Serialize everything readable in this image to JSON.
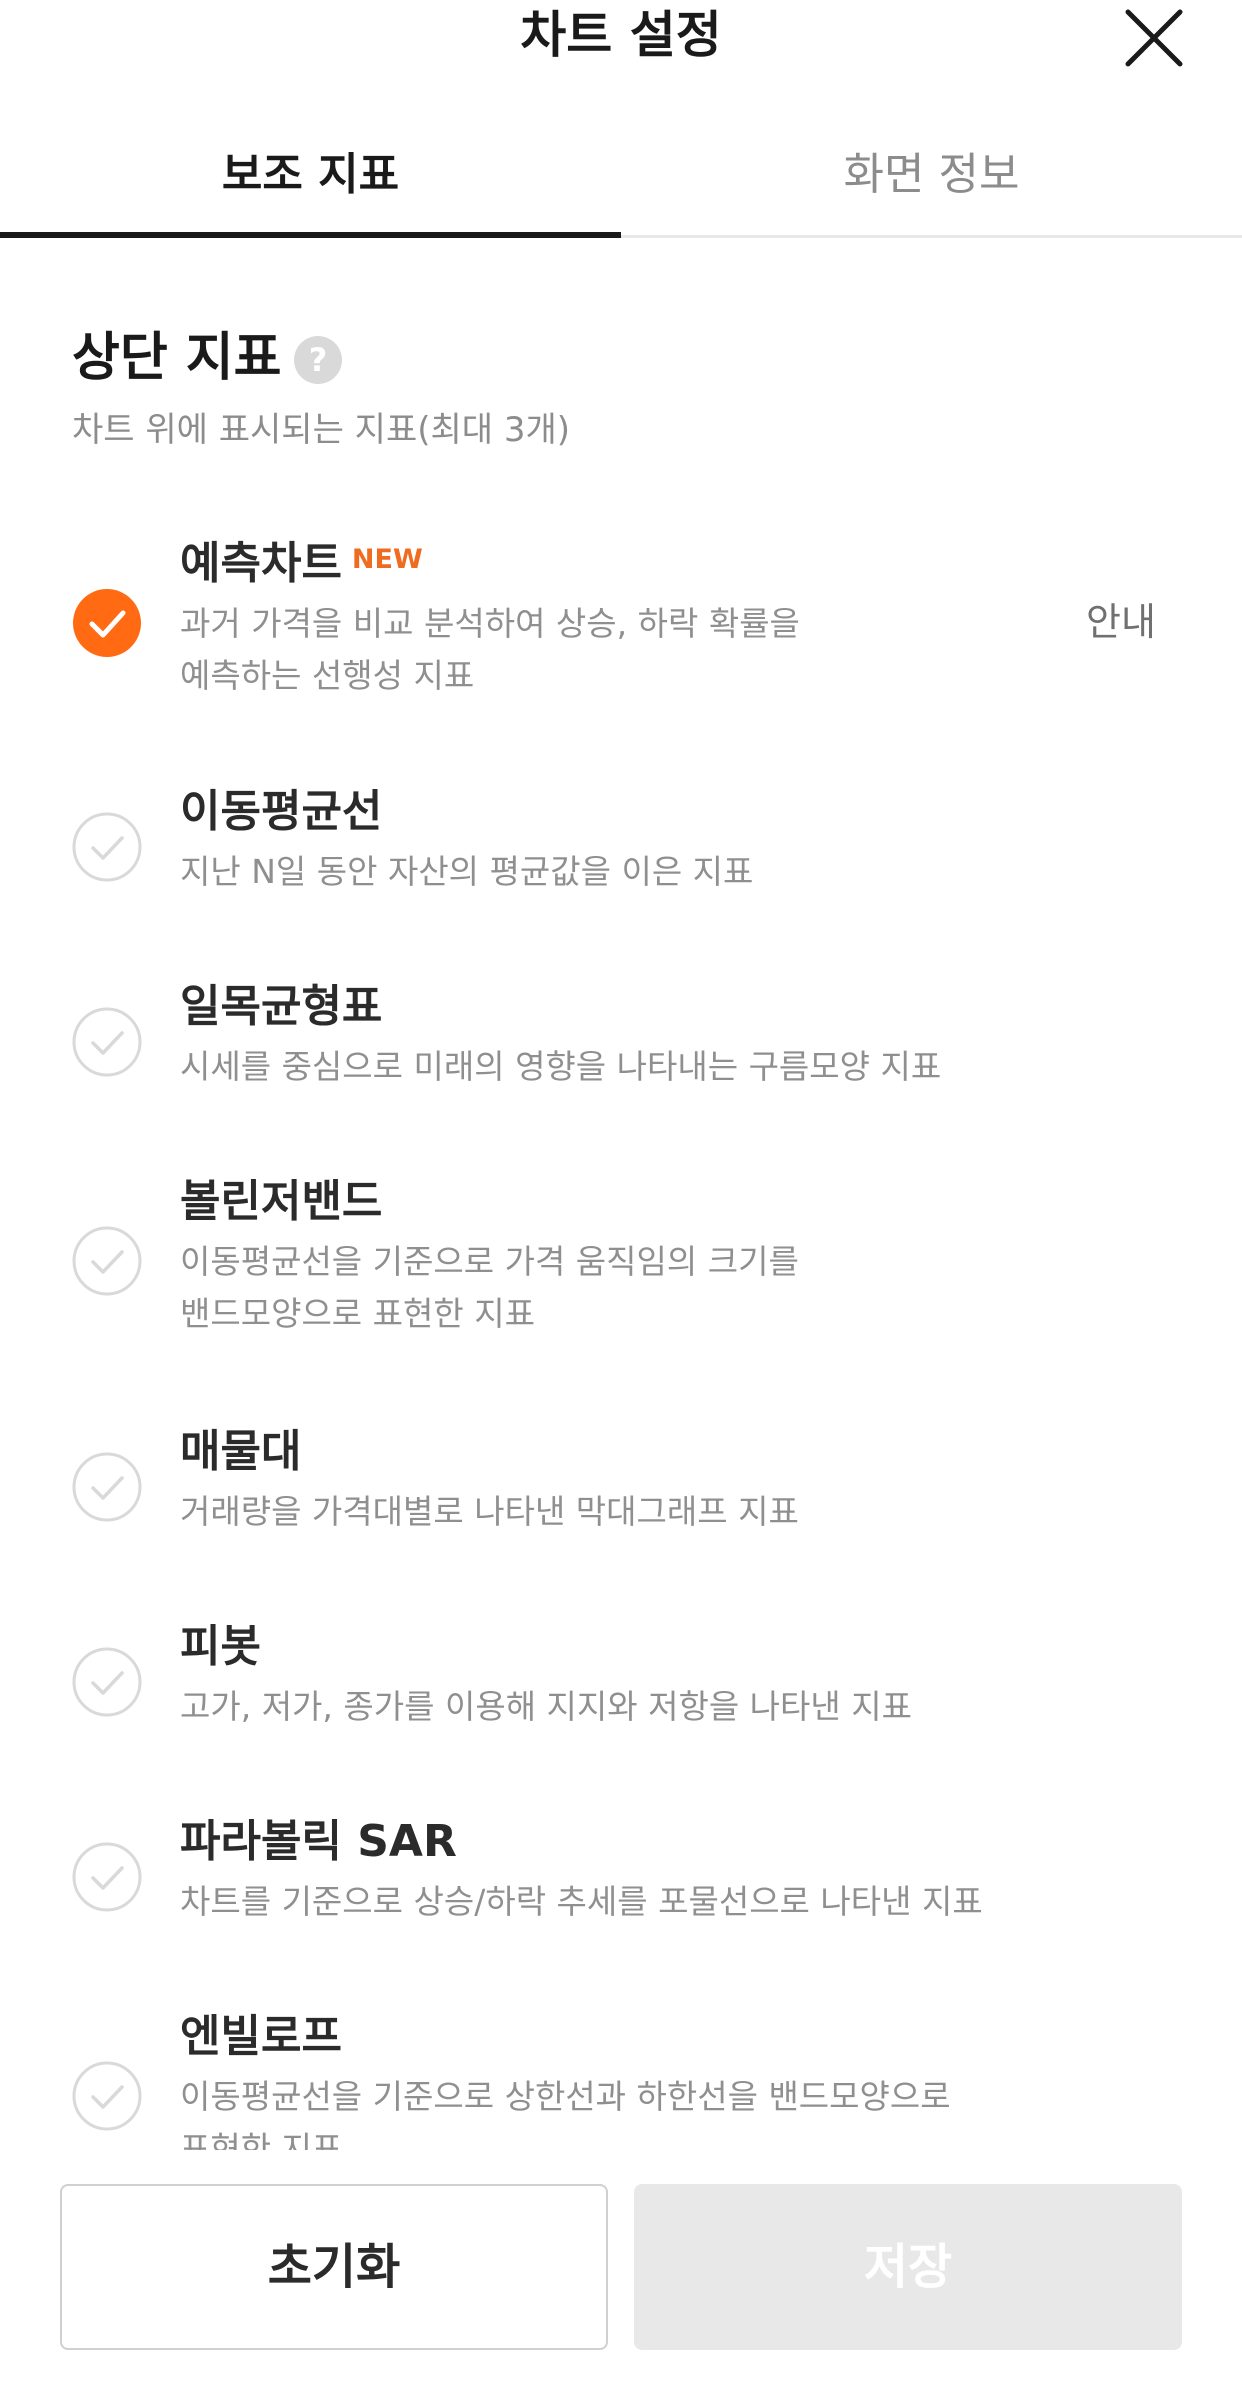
{
  "header": {
    "title": "차트 설정"
  },
  "tabs": [
    {
      "label": "보조 지표",
      "active": true
    },
    {
      "label": "화면 정보",
      "active": false
    }
  ],
  "section": {
    "title": "상단 지표",
    "help_symbol": "?",
    "subtitle": "차트 위에 표시되는 지표(최대 3개)"
  },
  "indicators": [
    {
      "title": "예측차트",
      "badge": "NEW",
      "desc_line1": "과거 가격을 비교 분석하여 상승, 하락 확률을",
      "desc_line2": "예측하는 선행성 지표",
      "info_label": "안내",
      "checked": true
    },
    {
      "title": "이동평균선",
      "desc_line1": "지난 N일 동안 자산의 평균값을 이은 지표",
      "checked": false
    },
    {
      "title": "일목균형표",
      "desc_line1": "시세를 중심으로 미래의 영향을 나타내는 구름모양 지표",
      "checked": false
    },
    {
      "title": "볼린저밴드",
      "desc_line1": "이동평균선을 기준으로 가격 움직임의 크기를",
      "desc_line2": "밴드모양으로 표현한 지표",
      "checked": false
    },
    {
      "title": "매물대",
      "desc_line1": "거래량을 가격대별로 나타낸 막대그래프 지표",
      "checked": false
    },
    {
      "title": "피봇",
      "desc_line1": "고가, 저가, 종가를 이용해 지지와 저항을 나타낸 지표",
      "checked": false
    },
    {
      "title": "파라볼릭 SAR",
      "desc_line1": "차트를 기준으로 상승/하락 추세를 포물선으로 나타낸 지표",
      "checked": false
    },
    {
      "title": "엔빌로프",
      "desc_line1": "이동평균선을 기준으로 상한선과 하한선을 밴드모양으로",
      "desc_line2": "표현한 지표",
      "checked": false
    }
  ],
  "buttons": {
    "reset_label": "초기화",
    "save_label": "저장"
  },
  "colors": {
    "accent": "#ff6a13",
    "check_inactive": "#d9d9d9",
    "text_primary": "#1a1a1a",
    "text_secondary": "#8f8f8f"
  },
  "icons": {
    "close": "close-icon",
    "help": "help-icon",
    "checked": "check-circle-filled-icon",
    "unchecked": "check-circle-outline-icon"
  }
}
